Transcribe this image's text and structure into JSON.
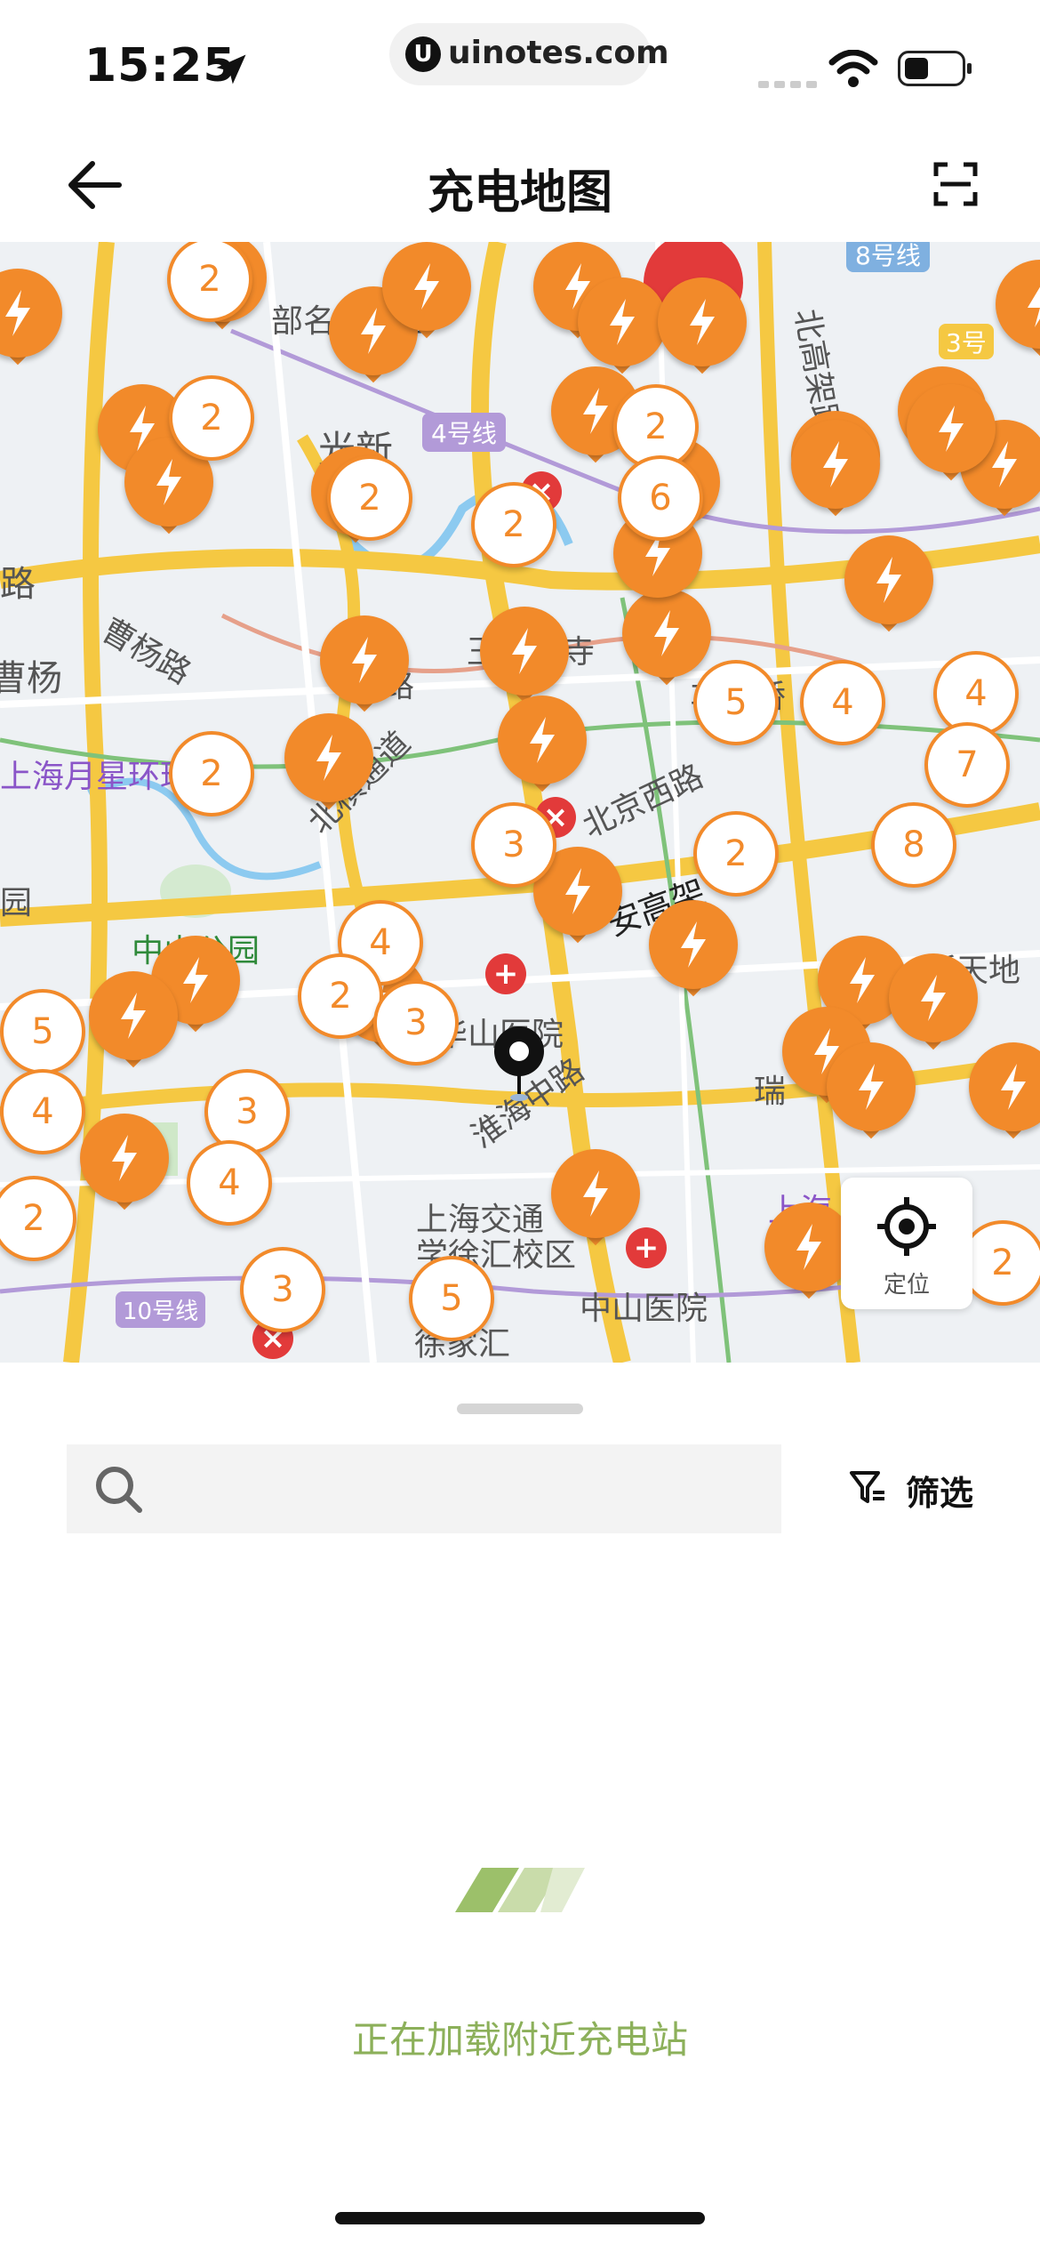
{
  "status_bar": {
    "time": "15:25",
    "url": "uinotes.com",
    "url_badge": "U"
  },
  "nav": {
    "title": "充电地图",
    "back_icon": "arrow-left-icon",
    "scan_icon": "scan-frame-icon"
  },
  "map": {
    "labels": {
      "l1": "部名都花园",
      "l2": "光新",
      "l3": "4号线",
      "l4": "曹杨路",
      "l5": "曹杨",
      "l6": "玉佛禅寺",
      "l7": "上海月星环球港",
      "l8": "北横通道",
      "l9": "中山公园",
      "l10": "华山医院",
      "l11": "淮海中路",
      "l12": "上海交通",
      "l13": "学徐汇校区",
      "l14": "中山医院",
      "l15": "10号线",
      "l16": "安高架",
      "l17": "北高架路",
      "l18": "8号线",
      "l19": "3号",
      "l20": "路",
      "l21": "瑞",
      "l22": "上海",
      "l23": "尔曼",
      "l24": "新天地",
      "l25": "北京西路",
      "l26": "路",
      "l27": "园",
      "l28": "徐家汇",
      "l29": "车路桥"
    },
    "clusters": [
      "2",
      "2",
      "2",
      "2",
      "2",
      "2",
      "5",
      "4",
      "7",
      "8",
      "3",
      "4",
      "2",
      "5",
      "4",
      "3",
      "4",
      "3",
      "2",
      "5",
      "2",
      "3",
      "2",
      "6",
      "4"
    ],
    "locate_label": "定位"
  },
  "sheet": {
    "search_placeholder": "",
    "filter_label": "筛选",
    "loading_text": "正在加载附近充电站"
  },
  "colors": {
    "pin_orange": "#f28a2a",
    "loading_green": "#8cb05a",
    "map_bg": "#eef1f4",
    "road_yellow": "#f5c842"
  }
}
